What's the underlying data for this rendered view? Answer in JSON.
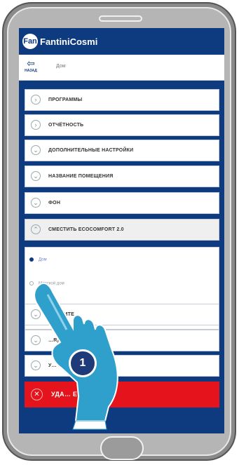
{
  "header": {
    "brand": "FantiniCosmi",
    "brand_mark": "Fan"
  },
  "subbar": {
    "back_label": "НАЗАД",
    "breadcrumb": "Дом"
  },
  "menu": [
    {
      "label": "ПРОГРАММЫ",
      "icon": "chevron-right-icon"
    },
    {
      "label": "ОТЧЁТНОСТЬ",
      "icon": "chevron-right-icon"
    },
    {
      "label": "ДОПОЛНИТЕЛЬНЫЕ НАСТРОЙКИ",
      "icon": "chevron-down-icon"
    },
    {
      "label": "НАЗВАНИЕ ПОМЕЩЕНИЯ",
      "icon": "chevron-down-icon"
    },
    {
      "label": "ФОН",
      "icon": "chevron-down-icon"
    },
    {
      "label": "СМЕСТИТЬ ECOCOMFORT 2.0",
      "icon": "chevron-up-icon"
    }
  ],
  "expanded": {
    "options": [
      {
        "label": "Дом",
        "selected": true
      },
      {
        "label": "Морской дом",
        "selected": false
      }
    ]
  },
  "lower_menu": [
    {
      "label": "…ДЕЛИТЕ"
    },
    {
      "label": "…R)"
    },
    {
      "label": "У… ECOCOMFORT 2.0"
    }
  ],
  "delete": {
    "label": "УДА… ЕНТИЛЯТОР"
  },
  "callout": {
    "number": "1"
  },
  "colors": {
    "brand_blue": "#0e3a80",
    "danger_red": "#e4131c"
  }
}
